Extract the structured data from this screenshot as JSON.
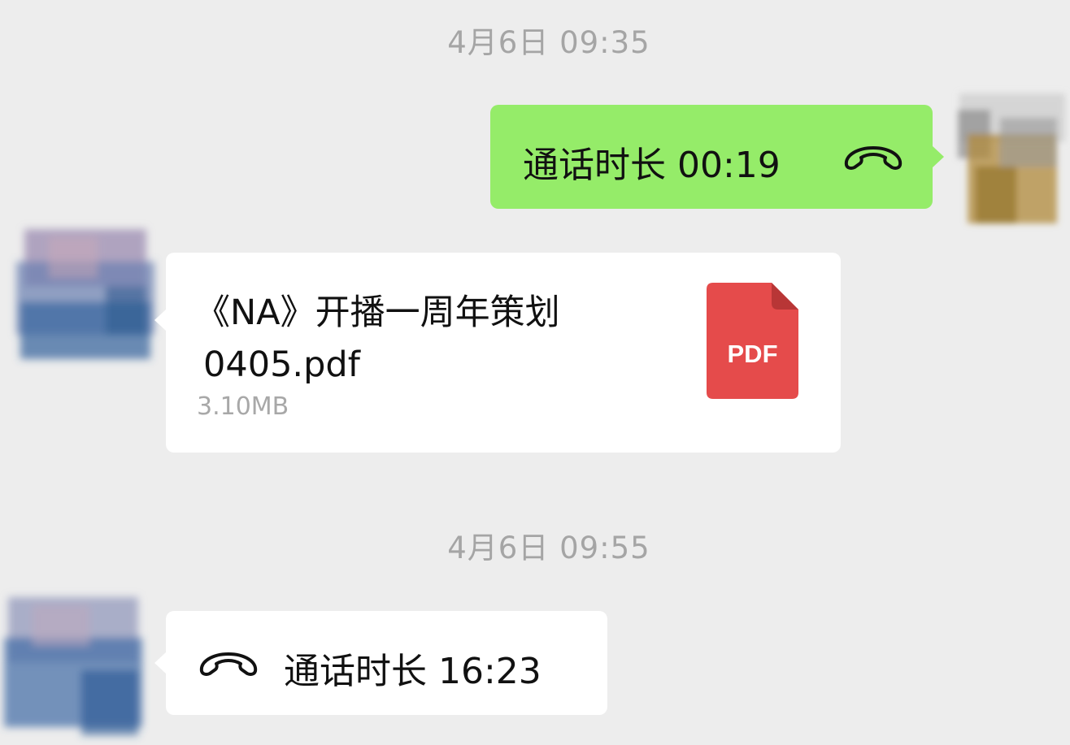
{
  "messages": {
    "timestamp_1": "4月6日 09:35",
    "call_out": {
      "label": "通话时长 00:19",
      "icon": "phone-hangup-icon"
    },
    "file": {
      "name_line1": "《NA》开播一周年策划",
      "name_line2": "0405.pdf",
      "size": "3.10MB",
      "type_label": "PDF"
    },
    "timestamp_2": "4月6日 09:55",
    "call_in": {
      "label": "通话时长 16:23",
      "icon": "phone-hangup-icon"
    }
  },
  "colors": {
    "background": "#ededed",
    "outgoing_bubble": "#95ec69",
    "incoming_bubble": "#ffffff",
    "pdf_icon": "#e54b4b",
    "timestamp_text": "#a5a5a5"
  }
}
